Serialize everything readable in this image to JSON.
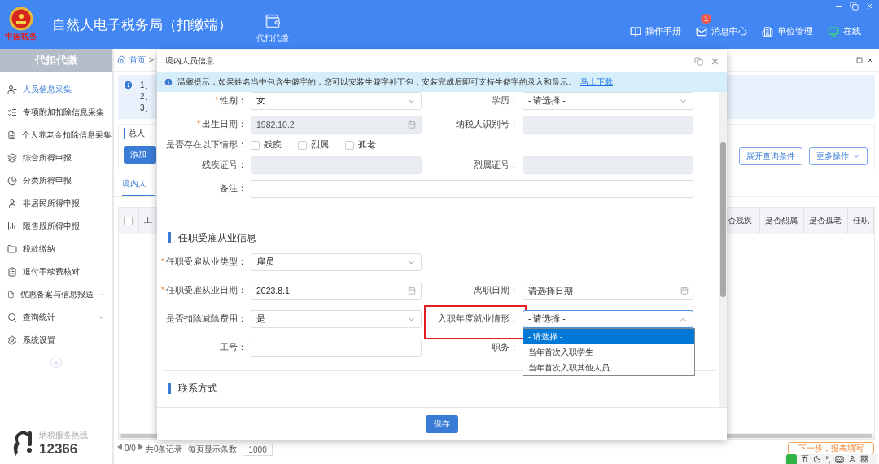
{
  "app": {
    "title": "自然人电子税务局（扣缴端）",
    "logo_text": "中国税务",
    "nav": [
      {
        "label": "代扣代缴",
        "selected": true
      }
    ],
    "actions": [
      {
        "label": "操作手册",
        "kind": "manual"
      },
      {
        "label": "消息中心",
        "kind": "messages",
        "badge": "1"
      },
      {
        "label": "单位管理",
        "kind": "units"
      },
      {
        "label": "在线",
        "kind": "status"
      }
    ]
  },
  "sidebar": {
    "title": "代扣代缴",
    "items": [
      {
        "label": "人员信息采集",
        "selected": true,
        "expandable": false
      },
      {
        "label": "专项附加扣除信息采集",
        "selected": false,
        "expandable": false
      },
      {
        "label": "个人养老金扣除信息采集",
        "selected": false,
        "expandable": false
      },
      {
        "label": "综合所得申报",
        "selected": false,
        "expandable": false
      },
      {
        "label": "分类所得申报",
        "selected": false,
        "expandable": false
      },
      {
        "label": "非居民所得申报",
        "selected": false,
        "expandable": false
      },
      {
        "label": "限售股所得申报",
        "selected": false,
        "expandable": false
      },
      {
        "label": "税款缴纳",
        "selected": false,
        "expandable": false
      },
      {
        "label": "退付手续费核对",
        "selected": false,
        "expandable": false
      },
      {
        "label": "优惠备案与信息报送",
        "selected": false,
        "expandable": true
      },
      {
        "label": "查询统计",
        "selected": false,
        "expandable": true
      },
      {
        "label": "系统设置",
        "selected": false,
        "expandable": false
      }
    ],
    "hotline": {
      "caption": "纳税服务热线",
      "number": "12366"
    }
  },
  "page": {
    "breadcrumb": {
      "home": "首页",
      "separator": ">"
    },
    "notes": [
      "1、",
      "2、",
      "3、"
    ],
    "summary_title": "总人",
    "add_button": "添加",
    "tab": {
      "label": "境内人",
      "selected": true
    },
    "buttons": [
      {
        "label": "展开查询条件",
        "kind": "plain"
      },
      {
        "label": "更多操作",
        "kind": "menu"
      }
    ],
    "select_all": {
      "checked": false
    },
    "columns_left": [
      "工"
    ],
    "columns_right": [
      "否残疾",
      "是否烈属",
      "是否孤老",
      "任职"
    ],
    "pager": {
      "position": "0/0",
      "total": "共0条记录",
      "page_size_label": "每页显示条数",
      "page_size": "1000"
    },
    "next_button": "下一步，报表填写"
  },
  "dialog": {
    "title": "境内人员信息",
    "required_mark": "*",
    "notice": {
      "label": "温馨提示：",
      "text": "如果姓名当中包含生僻字的，您可以安装生僻字补丁包，安装完成后即可支持生僻字的录入和显示。",
      "link": "马上下载"
    },
    "personal": [
      [
        {
          "label": "性别：",
          "required": true,
          "kind": "select",
          "value": "女",
          "disabled": false
        },
        {
          "label": "学历：",
          "required": false,
          "kind": "select",
          "value": "- 请选择 -",
          "disabled": false
        }
      ],
      [
        {
          "label": "出生日期：",
          "required": true,
          "kind": "date",
          "value": "1982.10.2",
          "disabled": true
        },
        {
          "label": "纳税人识别号：",
          "required": false,
          "kind": "text",
          "disabled": true
        }
      ],
      [
        {
          "label": "是否存在以下情形：",
          "required": false,
          "kind": "checks",
          "options": [
            {
              "label": "残疾",
              "checked": false
            },
            {
              "label": "烈属",
              "checked": false
            },
            {
              "label": "孤老",
              "checked": false
            }
          ]
        }
      ],
      [
        {
          "label": "残疾证号：",
          "required": false,
          "kind": "text",
          "disabled": true
        },
        {
          "label": "烈属证号：",
          "required": false,
          "kind": "text",
          "disabled": true
        }
      ],
      [
        {
          "label": "备注：",
          "required": false,
          "kind": "wide",
          "disabled": false
        }
      ]
    ],
    "sections": [
      {
        "title": "任职受雇从业信息",
        "rows": [
          [
            {
              "label": "任职受雇从业类型：",
              "required": true,
              "kind": "select",
              "value": "雇员",
              "disabled": false
            }
          ],
          [
            {
              "label": "任职受雇从业日期：",
              "required": true,
              "kind": "date",
              "value": "2023.8.1",
              "disabled": false
            },
            {
              "label": "离职日期：",
              "required": false,
              "kind": "date",
              "placeholder": "请选择日期",
              "disabled": false
            }
          ],
          [
            {
              "label": "是否扣除减除费用：",
              "required": false,
              "kind": "select",
              "value": "是",
              "disabled": false
            },
            {
              "label": "入职年度就业情形：",
              "required": false,
              "kind": "select",
              "value": "- 请选择 -",
              "disabled": false,
              "open": true,
              "highlighted": true,
              "options": [
                {
                  "label": "- 请选择 -",
                  "selected": true
                },
                {
                  "label": "当年首次入职学生",
                  "selected": false
                },
                {
                  "label": "当年首次入职其他人员",
                  "selected": false
                }
              ]
            }
          ],
          [
            {
              "label": "工号：",
              "required": false,
              "kind": "text",
              "disabled": false
            },
            {
              "label": "职务：",
              "required": false,
              "kind": "text"
            }
          ]
        ]
      },
      {
        "title": "联系方式"
      }
    ],
    "save": "保存"
  },
  "ime": {
    "mode": "五",
    "punct": "°,"
  }
}
